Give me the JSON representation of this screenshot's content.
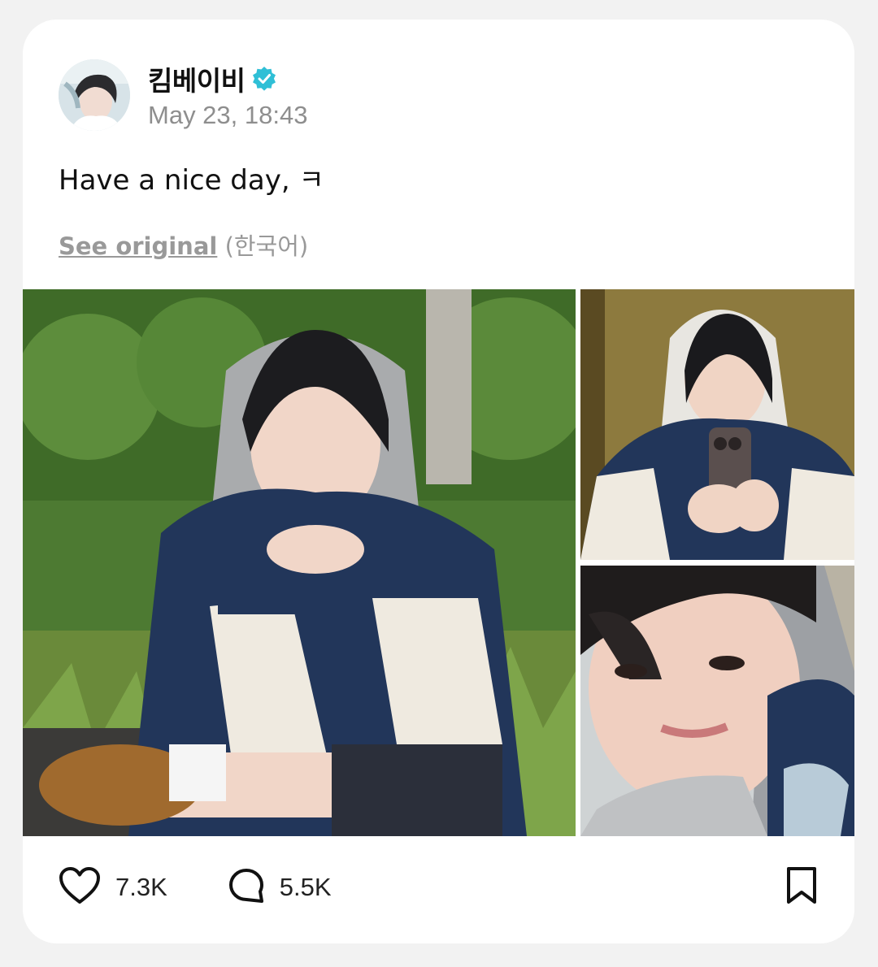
{
  "post": {
    "author": {
      "name": "킴베이비",
      "verified": true,
      "avatar_icon": "profile-photo"
    },
    "timestamp": "May 23, 18:43",
    "text": "Have a nice day, ㅋ",
    "translation": {
      "link_label": "See original",
      "language_note": "(한국어)"
    },
    "media": [
      {
        "name": "photo-sitting-outdoors",
        "description_icon": "image"
      },
      {
        "name": "photo-mirror-selfie",
        "description_icon": "image"
      },
      {
        "name": "photo-closeup-selfie",
        "description_icon": "image"
      }
    ],
    "stats": {
      "likes": "7.3K",
      "comments": "5.5K"
    }
  },
  "colors": {
    "verified_badge": "#2fbfd6",
    "text_primary": "#111111",
    "text_secondary": "#8e8e8e",
    "card_background": "#ffffff",
    "page_background": "#f2f2f2"
  },
  "icons": {
    "like": "heart-icon",
    "comment": "comment-bubble-icon",
    "bookmark": "bookmark-icon",
    "verified": "verified-badge-icon"
  }
}
